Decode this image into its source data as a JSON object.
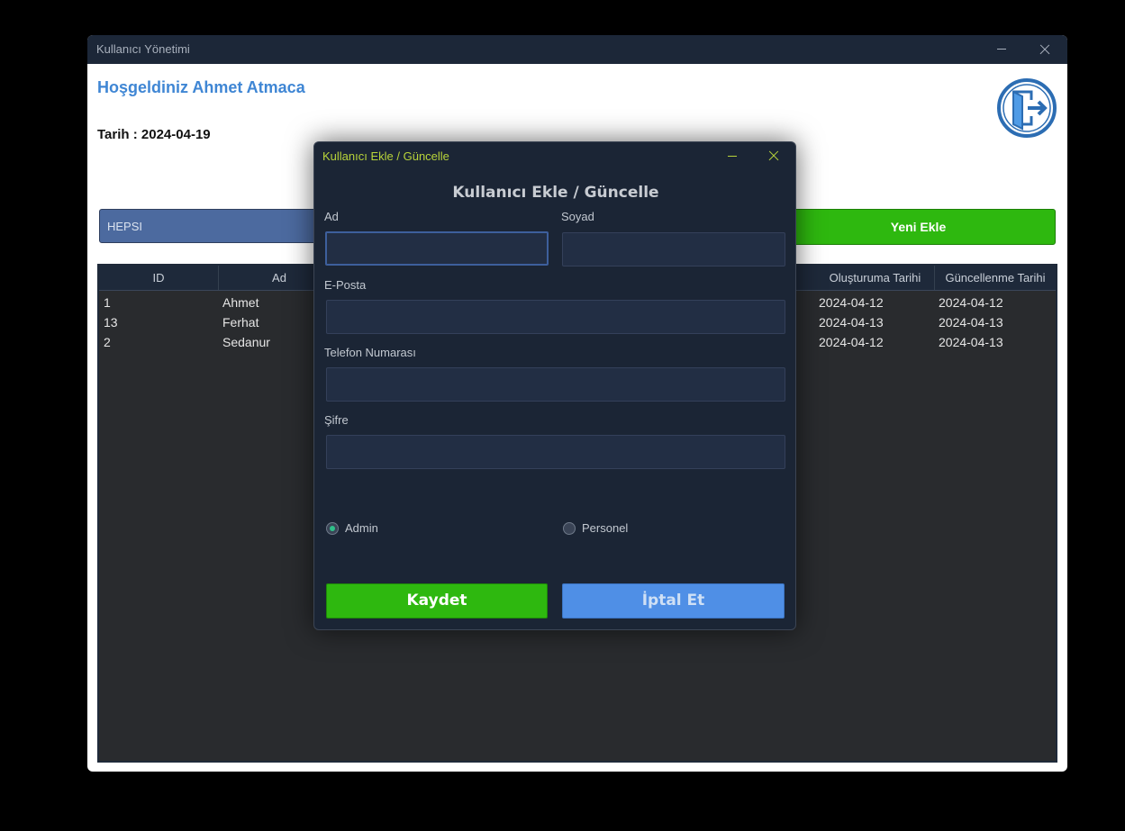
{
  "window": {
    "title": "Kullanıcı Yönetimi"
  },
  "header": {
    "welcome": "Hoşgeldiniz Ahmet Atmaca",
    "date_label": "Tarih :",
    "date_value": "2024-04-19"
  },
  "filter": {
    "selected": "HEPSI"
  },
  "new_button": {
    "label": "Yeni Ekle"
  },
  "table": {
    "columns": [
      "ID",
      "Ad",
      "Oluşturuma Tarihi",
      "Güncellenme Tarihi"
    ],
    "rows": [
      {
        "id": "1",
        "ad": "Ahmet",
        "created": "2024-04-12",
        "updated": "2024-04-12"
      },
      {
        "id": "13",
        "ad": "Ferhat",
        "created": "2024-04-13",
        "updated": "2024-04-13"
      },
      {
        "id": "2",
        "ad": "Sedanur",
        "created": "2024-04-12",
        "updated": "2024-04-13"
      }
    ]
  },
  "dialog": {
    "title": "Kullanıcı Ekle / Güncelle",
    "heading": "Kullanıcı Ekle / Güncelle",
    "fields": {
      "ad": {
        "label": "Ad",
        "value": ""
      },
      "soyad": {
        "label": "Soyad",
        "value": ""
      },
      "email": {
        "label": "E-Posta",
        "value": ""
      },
      "phone": {
        "label": "Telefon Numarası",
        "value": ""
      },
      "password": {
        "label": "Şifre",
        "value": ""
      }
    },
    "roles": {
      "admin": {
        "label": "Admin",
        "selected": true
      },
      "personel": {
        "label": "Personel",
        "selected": false
      }
    },
    "save_label": "Kaydet",
    "cancel_label": "İptal Et"
  },
  "colors": {
    "accent_blue": "#3f86d4",
    "green": "#2eb80f",
    "dialog_title": "#b8d43a"
  }
}
